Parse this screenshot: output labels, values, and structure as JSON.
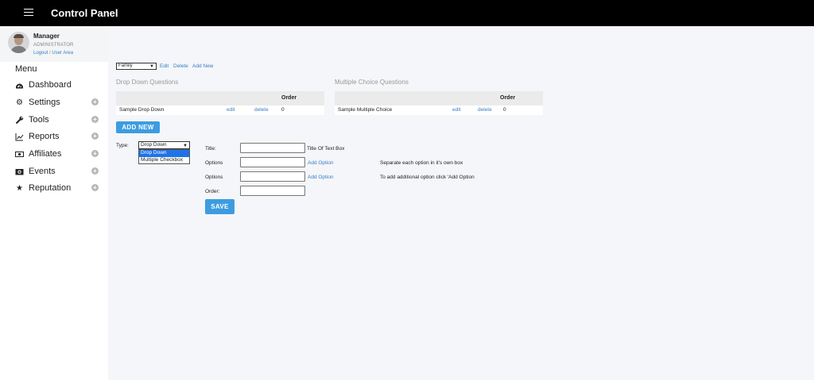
{
  "header": {
    "title": "Control Panel",
    "menu_icon": "hamburger-icon"
  },
  "profile": {
    "name": "Manager",
    "role": "ADMINISTRATOR",
    "logout_label": "Logout",
    "separator": " / ",
    "user_area_label": "User Area"
  },
  "sidebar": {
    "menu_label": "Menu",
    "items": [
      {
        "label": "Dashboard",
        "icon": "dashboard-icon",
        "expandable": false
      },
      {
        "label": "Settings",
        "icon": "gear-icon",
        "expandable": true
      },
      {
        "label": "Tools",
        "icon": "wrench-icon",
        "expandable": true
      },
      {
        "label": "Reports",
        "icon": "line-chart-icon",
        "expandable": true
      },
      {
        "label": "Affiliates",
        "icon": "money-icon",
        "expandable": true
      },
      {
        "label": "Events",
        "icon": "camera-icon",
        "expandable": true
      },
      {
        "label": "Reputation",
        "icon": "star-icon",
        "expandable": true
      }
    ],
    "expand_symbol": "+"
  },
  "toolbar": {
    "category_value": "Family",
    "edit_label": "Edit",
    "delete_label": "Delete",
    "add_new_label": "Add New"
  },
  "dropdown_questions": {
    "title": "Drop Down Questions",
    "order_header": "Order",
    "rows": [
      {
        "name": "Sample Drop Down",
        "edit": "edit",
        "delete": "delete",
        "order": "0"
      }
    ]
  },
  "multiple_choice_questions": {
    "title": "Multiple Choice Questions",
    "order_header": "Order",
    "rows": [
      {
        "name": "Sample Multiple Choice",
        "edit": "edit",
        "delete": "delete",
        "order": "0"
      }
    ]
  },
  "add_new_button": "ADD NEW",
  "form": {
    "type_label": "Type:",
    "type_selected": "Drop Down",
    "type_options": [
      "Drop Down",
      "Multiple Checkbox"
    ],
    "title_label": "Title:",
    "title_value": "",
    "title_hint": "Title Of Text Box",
    "options_label": "Options",
    "option_1_value": "",
    "option_2_value": "",
    "add_option_label": "Add Option",
    "options_hint_1": "Separate each option in it's own box",
    "options_hint_2": "To add additional option click 'Add Option",
    "order_label": "Order:",
    "order_value": "",
    "save_label": "SAVE"
  }
}
